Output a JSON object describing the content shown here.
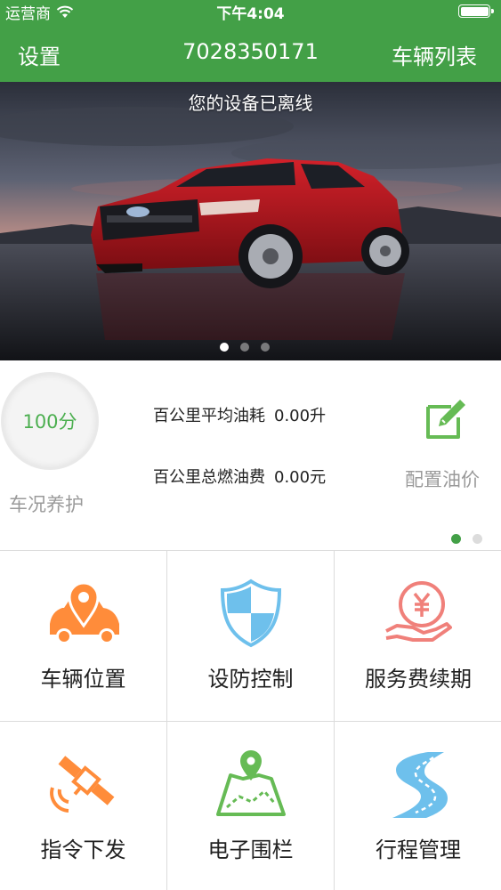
{
  "status_bar": {
    "carrier": "运营商",
    "time": "下午4:04"
  },
  "nav": {
    "left": "设置",
    "title": "7028350171",
    "right": "车辆列表"
  },
  "banner": {
    "offline_notice": "您的设备已离线",
    "slide_count": 3,
    "active_slide": 1
  },
  "info": {
    "score": "100分",
    "maintenance_label": "车况养护",
    "avg_fuel_label": "百公里平均油耗",
    "avg_fuel_value": "0.00升",
    "total_fuel_cost_label": "百公里总燃油费",
    "total_fuel_cost_value": "0.00元",
    "fuel_price_label": "配置油价",
    "page_count": 2,
    "active_page": 1
  },
  "grid": [
    {
      "label": "车辆位置",
      "icon": "car-location-icon"
    },
    {
      "label": "设防控制",
      "icon": "shield-icon"
    },
    {
      "label": "服务费续期",
      "icon": "yen-payment-icon"
    },
    {
      "label": "指令下发",
      "icon": "satellite-icon"
    },
    {
      "label": "电子围栏",
      "icon": "map-fence-icon"
    },
    {
      "label": "行程管理",
      "icon": "road-icon"
    }
  ],
  "colors": {
    "primary": "#43a047",
    "orange": "#ff8c3a",
    "blue": "#6ec0ec",
    "red": "#f0807a",
    "green": "#66bb55"
  }
}
